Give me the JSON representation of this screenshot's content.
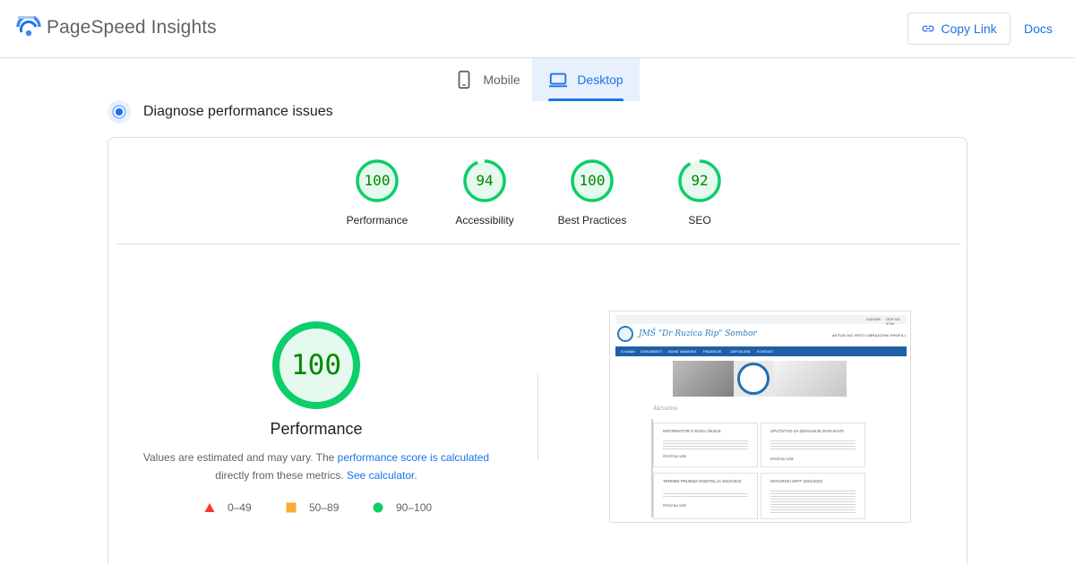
{
  "header": {
    "app_title": "PageSpeed Insights",
    "copy_link_label": "Copy Link",
    "docs_label": "Docs",
    "logo_icon": "pagespeed-logo-icon",
    "link_icon": "link-icon"
  },
  "tabs": [
    {
      "label": "Mobile",
      "icon": "mobile-icon",
      "selected": false
    },
    {
      "label": "Desktop",
      "icon": "desktop-icon",
      "selected": true
    }
  ],
  "diagnose": {
    "title": "Diagnose performance issues",
    "icon": "diagnose-icon"
  },
  "scores": [
    {
      "label": "Performance",
      "value": "100",
      "score": 1.0
    },
    {
      "label": "Accessibility",
      "value": "94",
      "score": 0.94
    },
    {
      "label": "Best Practices",
      "value": "100",
      "score": 1.0
    },
    {
      "label": "SEO",
      "value": "92",
      "score": 0.92
    }
  ],
  "main_gauge": {
    "value": "100",
    "score": 1.0,
    "label": "Performance"
  },
  "note": {
    "prefix": "Values are estimated and may vary. The ",
    "link1": "performance score is calculated",
    "middle": " directly from these metrics. ",
    "link2": "See calculator",
    "suffix": "."
  },
  "legend": [
    {
      "range": "0–49",
      "shape": "triangle",
      "color": "#ff3333"
    },
    {
      "range": "50–89",
      "shape": "square",
      "color": "#ffaa33"
    },
    {
      "range": "90–100",
      "shape": "circle",
      "color": "#0cce6b"
    }
  ],
  "colors": {
    "accent": "#1a73e8",
    "pass_ring": "#0cce6b",
    "pass_fill": "#e6f9ee",
    "pass_text": "#008800"
  },
  "thumbnail": {
    "topbar_links": [
      "KAKVAR",
      "DDP 941 0736"
    ],
    "site_name": "JMŠ \"Dr Ruzica Rip\" Sombor",
    "site_links": "AKTUELNO   VESTI   OBRAZOVNI PROFILI",
    "nav_items": [
      "O NAMA",
      "DOKUMENTI",
      "JAVNE NABAVKE",
      "FINANSIJE",
      "ZAPOSLENI",
      "KONTAKT"
    ],
    "section_title": "Aktuelno",
    "boxes": [
      {
        "title": "INFORMATOR O RADU ŠKOLE",
        "more": "PROČITAJ VIŠE"
      },
      {
        "title": "UPUTSTVO ZA IZDAVANJE DUPLIKATA",
        "more": "PROČITAJ VIŠE"
      },
      {
        "title": "TERMINI PRIJEMA RODITELJA 2022/2023",
        "more": "PROČITAJ VIŠE"
      },
      {
        "title": "MATURSKI ISPIT 2021/2022",
        "more": ""
      }
    ]
  }
}
